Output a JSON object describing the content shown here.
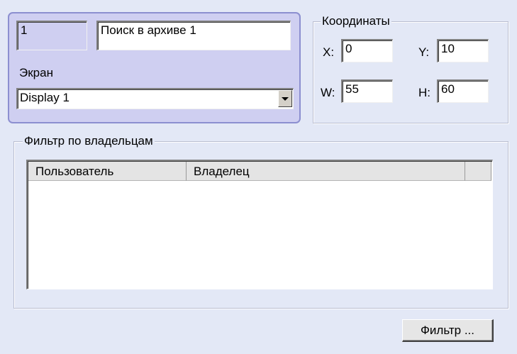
{
  "object": {
    "id_value": "1",
    "name_value": "Поиск в архиве 1",
    "screen_label": "Экран",
    "screen_selected": "Display 1"
  },
  "coords": {
    "title": "Координаты",
    "x_label": "X:",
    "x_value": "0",
    "y_label": "Y:",
    "y_value": "10",
    "w_label": "W:",
    "w_value": "55",
    "h_label": "H:",
    "h_value": "60"
  },
  "owner_filter": {
    "title": "Фильтр по владельцам",
    "columns": [
      "Пользователь",
      "Владелец"
    ],
    "rows": []
  },
  "actions": {
    "filter_button": "Фильтр ..."
  },
  "colors": {
    "background": "#e3e8f6",
    "panel_fill": "#cfcff1",
    "panel_border": "#8c8fd0"
  }
}
